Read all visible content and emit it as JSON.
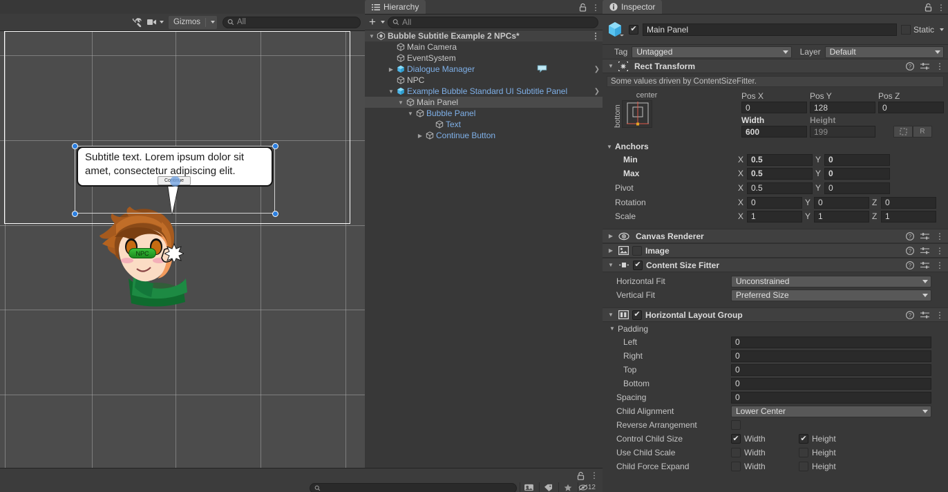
{
  "scene_view": {
    "toolbar": {
      "tools_icon": "tools-wrench-icon",
      "camera_icon": "camera-icon",
      "gizmos_label": "Gizmos",
      "search_icon": "search-icon",
      "search_placeholder": "All"
    },
    "bubble": {
      "text": "Subtitle text. Lorem ipsum dolor sit amet, consectetur adipiscing elit.",
      "continue_label": "Continue"
    },
    "npc_label": "NPC"
  },
  "project_bar": {
    "search_icon": "search-icon",
    "search_placeholder": "",
    "icons": [
      "scene-filter-icon",
      "label-filter-icon",
      "favorite-star-icon",
      "hidden-eye-icon"
    ],
    "hidden_count": "12",
    "lock_icon": "lock-icon",
    "menu_icon": "kebab-menu-icon"
  },
  "hierarchy": {
    "tab_label": "Hierarchy",
    "tab_icon": "hierarchy-list-icon",
    "lock_icon": "lock-icon",
    "menu_icon": "kebab-menu-icon",
    "add_label": "+",
    "search_icon": "search-icon",
    "search_placeholder": "All",
    "items": [
      {
        "label": "Bubble Subtitle Example 2 NPCs*",
        "depth": 0,
        "icon": "unity-scene-icon",
        "expanded": true,
        "kind": "scene",
        "selected": false,
        "has_arrow": false
      },
      {
        "label": "Main Camera",
        "depth": 2,
        "icon": "gameobject-cube-icon",
        "expanded": null,
        "kind": "plain",
        "selected": false,
        "has_arrow": false
      },
      {
        "label": "EventSystem",
        "depth": 2,
        "icon": "gameobject-cube-icon",
        "expanded": null,
        "kind": "plain",
        "selected": false,
        "has_arrow": false
      },
      {
        "label": "Dialogue Manager",
        "depth": 2,
        "icon": "prefab-cube-icon",
        "expanded": false,
        "kind": "prefab",
        "selected": false,
        "has_arrow": true,
        "badge": "speech-bubble-gizmo-icon"
      },
      {
        "label": "NPC",
        "depth": 2,
        "icon": "gameobject-cube-icon",
        "expanded": null,
        "kind": "plain",
        "selected": false,
        "has_arrow": false
      },
      {
        "label": "Example Bubble Standard UI Subtitle Panel",
        "depth": 2,
        "icon": "prefab-cube-icon",
        "expanded": true,
        "kind": "prefab",
        "selected": false,
        "has_arrow": true
      },
      {
        "label": "Main Panel",
        "depth": 3,
        "icon": "gameobject-cube-icon",
        "expanded": true,
        "kind": "plain",
        "selected": true,
        "has_arrow": false
      },
      {
        "label": "Bubble Panel",
        "depth": 4,
        "icon": "gameobject-cube-icon",
        "expanded": true,
        "kind": "prefab",
        "selected": false,
        "has_arrow": false
      },
      {
        "label": "Text",
        "depth": 6,
        "icon": "gameobject-cube-icon",
        "expanded": null,
        "kind": "prefab",
        "selected": false,
        "has_arrow": false
      },
      {
        "label": "Continue Button",
        "depth": 5,
        "icon": "gameobject-cube-icon",
        "expanded": false,
        "kind": "prefab",
        "selected": false,
        "has_arrow": false
      }
    ]
  },
  "inspector": {
    "tab_label": "Inspector",
    "tab_icon": "info-circle-icon",
    "lock_icon": "lock-icon",
    "menu_icon": "kebab-menu-icon",
    "object": {
      "icon": "prefab-cube-icon",
      "enabled": true,
      "name": "Main Panel",
      "static_label": "Static",
      "static_checked": false,
      "tag_label": "Tag",
      "tag_value": "Untagged",
      "layer_label": "Layer",
      "layer_value": "Default"
    },
    "rect_transform": {
      "title": "Rect Transform",
      "icon": "rect-transform-icon",
      "notice": "Some values driven by ContentSizeFitter.",
      "anchor_preset": {
        "h_label": "center",
        "v_label": "bottom"
      },
      "pos_x_label": "Pos X",
      "pos_x": "0",
      "pos_y_label": "Pos Y",
      "pos_y": "128",
      "pos_z_label": "Pos Z",
      "pos_z": "0",
      "width_label": "Width",
      "width": "600",
      "height_label": "Height",
      "height": "199",
      "blueprint_button": "blueprint-mode-icon",
      "raw_button": "R",
      "anchors_label": "Anchors",
      "min_label": "Min",
      "min_x": "0.5",
      "min_y": "0",
      "max_label": "Max",
      "max_x": "0.5",
      "max_y": "0",
      "pivot_label": "Pivot",
      "pivot_x": "0.5",
      "pivot_y": "0",
      "rotation_label": "Rotation",
      "rot_x": "0",
      "rot_y": "0",
      "rot_z": "0",
      "scale_label": "Scale",
      "scale_x": "1",
      "scale_y": "1",
      "scale_z": "1",
      "axis_x": "X",
      "axis_y": "Y",
      "axis_z": "Z"
    },
    "canvas_renderer": {
      "title": "Canvas Renderer",
      "icon": "eye-icon"
    },
    "image": {
      "title": "Image",
      "icon": "image-icon"
    },
    "content_size_fitter": {
      "title": "Content Size Fitter",
      "icon": "content-size-fitter-icon",
      "enabled": true,
      "horizontal_fit_label": "Horizontal Fit",
      "horizontal_fit_value": "Unconstrained",
      "vertical_fit_label": "Vertical Fit",
      "vertical_fit_value": "Preferred Size"
    },
    "horizontal_layout_group": {
      "title": "Horizontal Layout Group",
      "icon": "horizontal-layout-icon",
      "enabled": true,
      "padding_label": "Padding",
      "left_label": "Left",
      "left": "0",
      "right_label": "Right",
      "right": "0",
      "top_label": "Top",
      "top": "0",
      "bottom_label": "Bottom",
      "bottom": "0",
      "spacing_label": "Spacing",
      "spacing": "0",
      "child_alignment_label": "Child Alignment",
      "child_alignment_value": "Lower Center",
      "reverse_arrangement_label": "Reverse Arrangement",
      "reverse_arrangement_checked": false,
      "control_child_size_label": "Control Child Size",
      "control_child_width": true,
      "control_child_height": true,
      "use_child_scale_label": "Use Child Scale",
      "use_child_scale_width": false,
      "use_child_scale_height": false,
      "child_force_expand_label": "Child Force Expand",
      "child_force_expand_width": false,
      "child_force_expand_height": false,
      "width_label": "Width",
      "height_label": "Height"
    },
    "help_icon": "help-circle-icon",
    "preset_icon": "preset-sliders-icon",
    "context_icon": "kebab-menu-icon"
  },
  "colors": {
    "accent_blue": "#7fb0e8",
    "prefab_cube": "#4cb4e7",
    "panel_bg": "#383838",
    "header_bg": "#3c3c3c",
    "field_bg": "#2a2a2a",
    "selection": "#4a4a4a",
    "npc_badge_green": "#2fa832",
    "handle_blue": "#2c7fe0"
  }
}
